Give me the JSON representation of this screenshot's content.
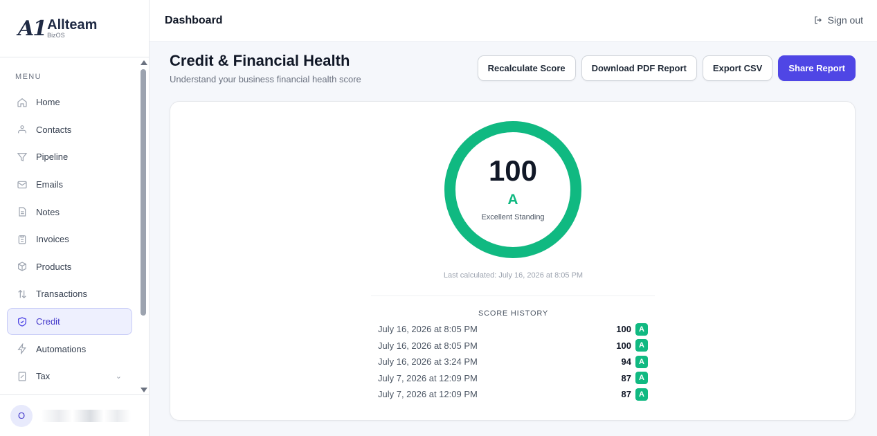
{
  "brand": {
    "mark": "A1",
    "name": "Allteam",
    "sub": "BizOS"
  },
  "sidebar": {
    "menu_label": "MENU",
    "items": [
      {
        "label": "Home",
        "icon": "home-icon"
      },
      {
        "label": "Contacts",
        "icon": "contacts-icon"
      },
      {
        "label": "Pipeline",
        "icon": "funnel-icon"
      },
      {
        "label": "Emails",
        "icon": "mail-icon"
      },
      {
        "label": "Notes",
        "icon": "note-icon"
      },
      {
        "label": "Invoices",
        "icon": "clipboard-icon"
      },
      {
        "label": "Products",
        "icon": "box-icon"
      },
      {
        "label": "Transactions",
        "icon": "arrows-updown-icon"
      },
      {
        "label": "Credit",
        "icon": "shield-icon",
        "active": true
      },
      {
        "label": "Automations",
        "icon": "bolt-icon"
      },
      {
        "label": "Tax",
        "icon": "receipt-icon"
      }
    ],
    "user_initial": "O"
  },
  "topbar": {
    "title": "Dashboard",
    "signout": "Sign out"
  },
  "page": {
    "title": "Credit & Financial Health",
    "subtitle": "Understand your business financial health score",
    "actions": {
      "recalc": "Recalculate Score",
      "pdf": "Download PDF Report",
      "csv": "Export CSV",
      "share": "Share Report"
    }
  },
  "score": {
    "value": "100",
    "grade": "A",
    "standing": "Excellent Standing",
    "last_calculated": "Last calculated: July 16, 2026 at 8:05 PM",
    "ring_color": "#10b981"
  },
  "history": {
    "title": "SCORE HISTORY",
    "rows": [
      {
        "date": "July 16, 2026 at 8:05 PM",
        "score": "100",
        "grade": "A"
      },
      {
        "date": "July 16, 2026 at 8:05 PM",
        "score": "100",
        "grade": "A"
      },
      {
        "date": "July 16, 2026 at 3:24 PM",
        "score": "94",
        "grade": "A"
      },
      {
        "date": "July 7, 2026 at 12:09 PM",
        "score": "87",
        "grade": "A"
      },
      {
        "date": "July 7, 2026 at 12:09 PM",
        "score": "87",
        "grade": "A"
      }
    ]
  },
  "colors": {
    "accent": "#4f46e5",
    "success": "#10b981"
  }
}
